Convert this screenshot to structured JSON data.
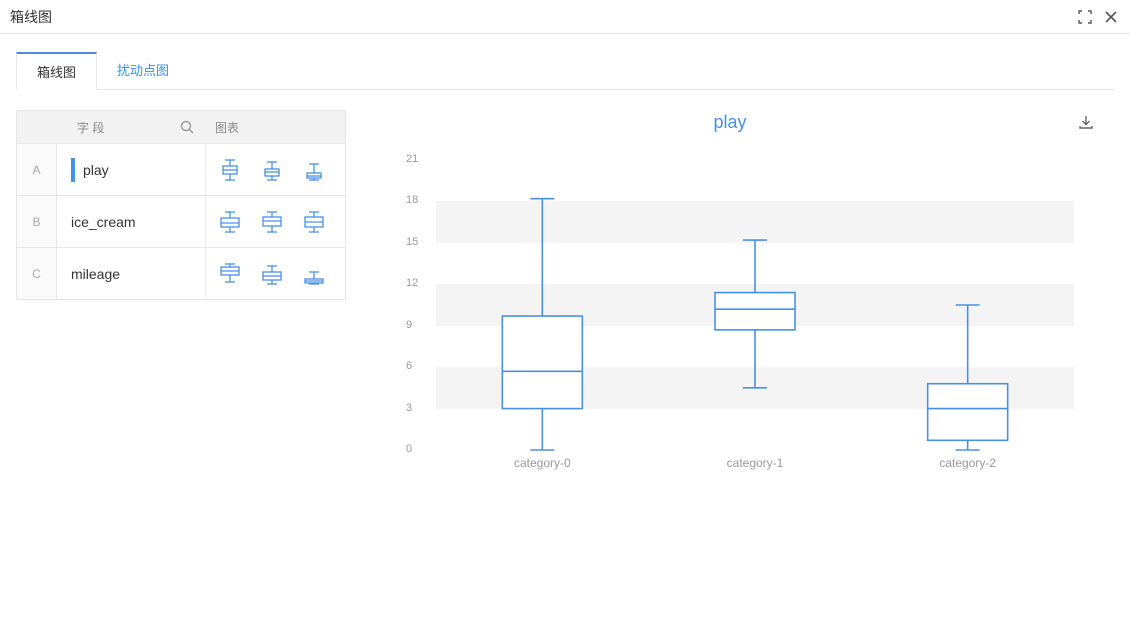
{
  "window": {
    "title": "箱线图"
  },
  "tabs": [
    {
      "label": "箱线图",
      "active": true
    },
    {
      "label": "扰动点图",
      "active": false
    }
  ],
  "sidebar": {
    "header": {
      "field_label": "字 段",
      "chart_label": "图表"
    },
    "rows": [
      {
        "letter": "A",
        "name": "play",
        "selected": true
      },
      {
        "letter": "B",
        "name": "ice_cream",
        "selected": false
      },
      {
        "letter": "C",
        "name": "mileage",
        "selected": false
      }
    ]
  },
  "chart": {
    "title": "play",
    "ylim": [
      0,
      21
    ],
    "yticks": [
      0,
      3,
      6,
      9,
      12,
      15,
      18,
      21
    ],
    "categories": [
      "category-0",
      "category-1",
      "category-2"
    ]
  },
  "chart_data": {
    "type": "boxplot",
    "title": "play",
    "xlabel": "",
    "ylabel": "",
    "ylim": [
      0,
      21
    ],
    "categories": [
      "category-0",
      "category-1",
      "category-2"
    ],
    "series": [
      {
        "name": "play",
        "boxes": [
          {
            "category": "category-0",
            "min": 0.0,
            "q1": 3.0,
            "median": 5.7,
            "q3": 9.7,
            "max": 18.2
          },
          {
            "category": "category-1",
            "min": 4.5,
            "q1": 8.7,
            "median": 10.2,
            "q3": 11.4,
            "max": 15.2
          },
          {
            "category": "category-2",
            "min": 0.0,
            "q1": 0.7,
            "median": 3.0,
            "q3": 4.8,
            "max": 10.5
          }
        ]
      }
    ]
  }
}
